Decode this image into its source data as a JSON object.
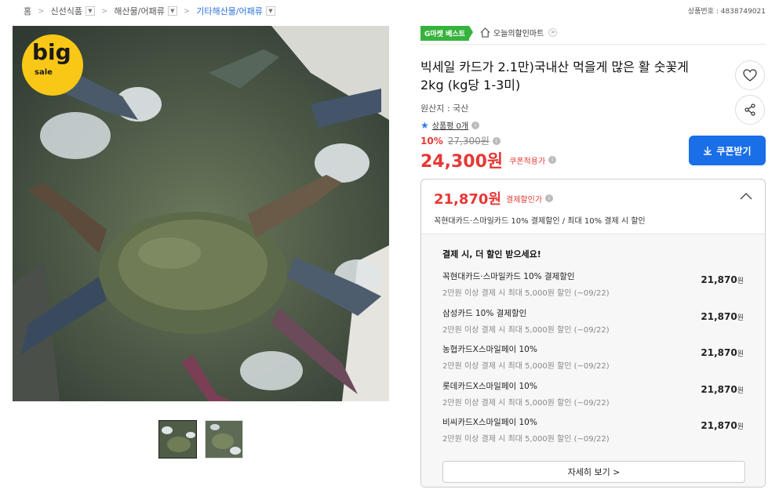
{
  "breadcrumb": {
    "home": "홈",
    "items": [
      "신선식품",
      "해산물/어패류",
      "기타해산물/어패류"
    ]
  },
  "product_no": "상품번호 : 4838749021",
  "image": {
    "badge_big": "big",
    "badge_sale": "sale"
  },
  "tags": {
    "best": "G마켓 베스트",
    "store": "오늘의할인마트"
  },
  "product": {
    "title": "빅세일 카드가 2.1만)국내산 먹을게 많은 활 숫꽃게 2kg (kg당 1-3미)",
    "origin": "원산지 : 국산",
    "review": "상품평 0개",
    "discount_rate": "10%",
    "original_price": "27,300원",
    "sale_price": "24,300원",
    "coupon_applied": "쿠폰적용가",
    "coupon_button": "쿠폰받기"
  },
  "card": {
    "price": "21,870원",
    "price_label": "결제할인가",
    "subtitle": "꼭현대카드·스마일카드 10% 결제할인 / 최대 10% 결제 시 할인",
    "heading": "결제 시, 더 할인 받으세요!",
    "offers": [
      {
        "name": "꼭현대카드·스마일카드 10% 결제할인",
        "cond": "2만원 이상 결제 시 최대 5,000원 할인 (~09/22)",
        "amount": "21,870",
        "unit": "원"
      },
      {
        "name": "삼성카드 10% 결제할인",
        "cond": "2만원 이상 결제 시 최대 5,000원 할인 (~09/22)",
        "amount": "21,870",
        "unit": "원"
      },
      {
        "name": "농협카드X스마일페이 10%",
        "cond": "2만원 이상 결제 시 최대 5,000원 할인 (~09/22)",
        "amount": "21,870",
        "unit": "원"
      },
      {
        "name": "롯데카드X스마일페이 10%",
        "cond": "2만원 이상 결제 시 최대 5,000원 할인 (~09/22)",
        "amount": "21,870",
        "unit": "원"
      },
      {
        "name": "비씨카드X스마일페이 10%",
        "cond": "2만원 이상 결제 시 최대 5,000원 할인 (~09/22)",
        "amount": "21,870",
        "unit": "원"
      }
    ],
    "more": "자세히 보기 >"
  },
  "colors": {
    "accent_red": "#e53935",
    "button_blue": "#1a6ee8",
    "best_green": "#36b33d",
    "badge_yellow": "#f9c816"
  }
}
